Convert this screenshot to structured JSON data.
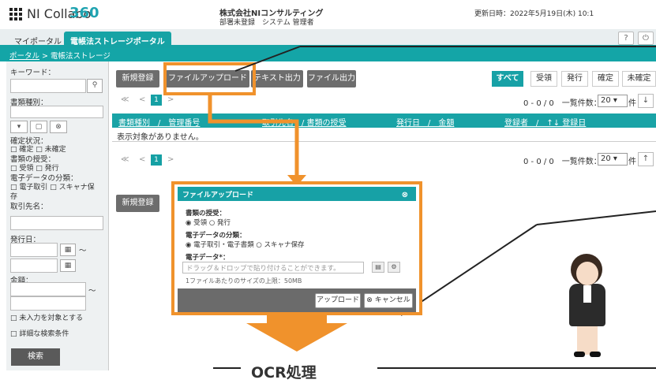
{
  "header": {
    "logo_text": "NI Collabo",
    "logo_version": "360",
    "company": "株式会社NIコンサルティング",
    "user": "部署未登録　システム 管理者",
    "updated": "更新日時：2022年5月19日(木) 10:1"
  },
  "tabs": [
    {
      "label": "マイポータル",
      "active": false
    },
    {
      "label": "電帳法ストレージポータル",
      "active": true
    }
  ],
  "top_buttons": [
    "?",
    "⏻"
  ],
  "breadcrumb": {
    "portal": "ポータル",
    "sep": ">",
    "current": "電帳法ストレージ"
  },
  "sidebar": {
    "keyword_label": "キーワード：",
    "doc_type_label": "書類種別：",
    "confirm_label": "確定状況：",
    "confirm_opts": "□ 確定 □ 未確定",
    "transfer_label": "書類の授受：",
    "transfer_opts": "□ 受領 □ 発行",
    "edata_label": "電子データの分類：",
    "edata_opts": "□ 電子取引 □ スキャナ保",
    "edata_opts2": "存",
    "partner_label": "取引先名：",
    "issue_label": "発行日：",
    "tilde": "〜",
    "amount_label": "金額：",
    "unentered": "□ 未入力を対象とする",
    "detail": "□ 詳細な検索条件",
    "search": "検索"
  },
  "toolbar": {
    "new": "新規登録",
    "upload": "ファイルアップロード",
    "text_out": "テキスト出力",
    "file_out": "ファイル出力"
  },
  "filters": [
    "すべて",
    "受領",
    "発行",
    "確定",
    "未確定"
  ],
  "pager": {
    "first": "≪",
    "prev": "<",
    "page": "1",
    "next": ">",
    "count": "0 - 0 / 0　一覧件数：",
    "per_page": "20",
    "unit": "件"
  },
  "table": {
    "col1": "書類種別　/　管理番号",
    "col2": "取引先名　/ 書類の授受",
    "col3": "発行日　/　金額",
    "col4": "登録者　/　↑↓ 登録日",
    "empty": "表示対象がありません。"
  },
  "dialog": {
    "title": "ファイルアップロード",
    "transfer_label": "書類の授受：",
    "transfer_opts": "◉ 受領 ○ 発行",
    "edata_label": "電子データの分類：",
    "edata_opts": "◉ 電子取引・電子書類 ○ スキャナ保存",
    "file_label": "電子データ*：",
    "drop_placeholder": "ドラッグ＆ドロップで貼り付けることができます。",
    "limit": "1ファイルあたりのサイズの上限：50MB",
    "upload_btn": "アップロード",
    "cancel_btn": "⊗ キャンセル"
  },
  "callout": "OCR処理",
  "colors": {
    "accent": "#16a3a5",
    "highlight": "#f0922c"
  }
}
